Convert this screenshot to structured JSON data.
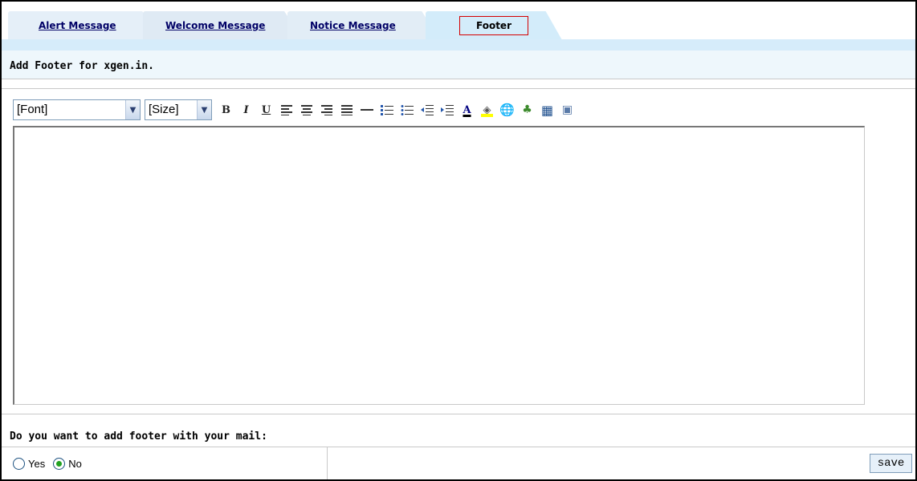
{
  "tabs": [
    {
      "label": "Alert Message"
    },
    {
      "label": "Welcome Message"
    },
    {
      "label": "Notice Message"
    },
    {
      "label": "Footer"
    }
  ],
  "active_tab": "Footer",
  "section": {
    "title": "Add Footer for xgen.in."
  },
  "toolbar": {
    "font_select": "[Font]",
    "size_select": "[Size]",
    "bold": "B",
    "italic": "I",
    "underline": "U",
    "font_color": "A",
    "icons": [
      "bold-icon",
      "italic-icon",
      "underline-icon",
      "align-left-icon",
      "align-center-icon",
      "align-right-icon",
      "align-justify-icon",
      "horizontal-rule-icon",
      "ordered-list-icon",
      "unordered-list-icon",
      "outdent-icon",
      "indent-icon",
      "font-color-icon",
      "background-color-icon",
      "hyperlink-icon",
      "image-icon",
      "table-icon",
      "picture-icon"
    ]
  },
  "question": {
    "text": "Do you want to add footer with your mail:"
  },
  "options": [
    {
      "label": "Yes",
      "checked": false
    },
    {
      "label": "No",
      "checked": true
    }
  ],
  "save_label": "save",
  "colors": {
    "tab_strip": "#d6ecfa",
    "header_bg": "#eef7fc",
    "active_border": "#d40000",
    "radio_fill": "#21a121"
  }
}
